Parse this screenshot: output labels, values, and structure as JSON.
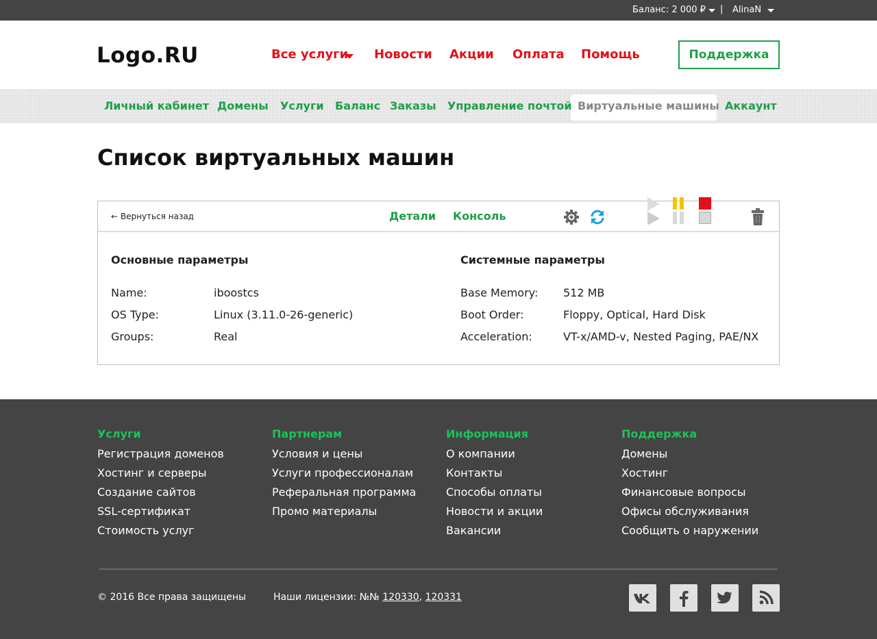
{
  "topbar": {
    "balance": "Баланс: 2 000 ₽",
    "separator": "|",
    "username": "AlinaN"
  },
  "header": {
    "logo": "Logo.RU",
    "nav": [
      "Все услуги",
      "Новости",
      "Акции",
      "Оплата",
      "Помощь"
    ],
    "support_button": "Поддержка"
  },
  "subnav": {
    "items": [
      "Личный кабинет",
      "Домены",
      "Услуги",
      "Баланс",
      "Заказы",
      "Управление почтой",
      "Виртуальные машины",
      "Аккаунт"
    ],
    "active": "Виртуальные машины"
  },
  "page": {
    "title": "Список виртуальных машин"
  },
  "panel": {
    "back": "← Вернуться назад",
    "tabs": [
      "Детали",
      "Консоль"
    ],
    "tool_icons": [
      "gear-icon",
      "refresh-icon",
      "play-icon",
      "pause-icon",
      "stop-icon",
      "trash-icon"
    ],
    "main_section": {
      "title": "Основные параметры",
      "rows": [
        {
          "label": "Name:",
          "value": "iboostcs"
        },
        {
          "label": "OS Type:",
          "value": "Linux (3.11.0-26-generic)"
        },
        {
          "label": "Groups:",
          "value": "Real"
        }
      ]
    },
    "system_section": {
      "title": "Системные параметры",
      "rows": [
        {
          "label": "Base Memory:",
          "value": "512 MB"
        },
        {
          "label": "Boot Order:",
          "value": "Floppy, Optical, Hard Disk"
        },
        {
          "label": "Acceleration:",
          "value": "VT-x/AMD-v, Nested Paging, PAE/NX"
        }
      ]
    }
  },
  "footer": {
    "columns": [
      {
        "title": "Услуги",
        "items": [
          "Регистрация доменов",
          "Хостинг и серверы",
          "Создание сайтов",
          "SSL-сертификат",
          "Стоимость услуг"
        ]
      },
      {
        "title": "Партнерам",
        "items": [
          "Условия и цены",
          "Услуги профессионалам",
          "Реферальная программа",
          "Промо материалы"
        ]
      },
      {
        "title": "Информация",
        "items": [
          "О компании",
          "Контакты",
          "Способы оплаты",
          "Новости и акции",
          "Вакансии"
        ]
      },
      {
        "title": "Поддержка",
        "items": [
          "Домены",
          "Хостинг",
          "Финансовые вопросы",
          "Офисы обслуживания",
          "Сообщить о наружении"
        ]
      }
    ],
    "copyright": "© 2016 Все права защищены",
    "licenses_prefix": "Наши лицензии: №№",
    "license_1": "120330",
    "license_sep": ",",
    "license_2": "120331",
    "social": [
      "vk-icon",
      "facebook-icon",
      "twitter-icon",
      "rss-icon"
    ]
  },
  "colors": {
    "brand_green": "#1e9e4a",
    "brand_red": "#e3101a",
    "dark": "#444444",
    "pause_yellow": "#f5c400",
    "stop_red": "#e3101a"
  }
}
